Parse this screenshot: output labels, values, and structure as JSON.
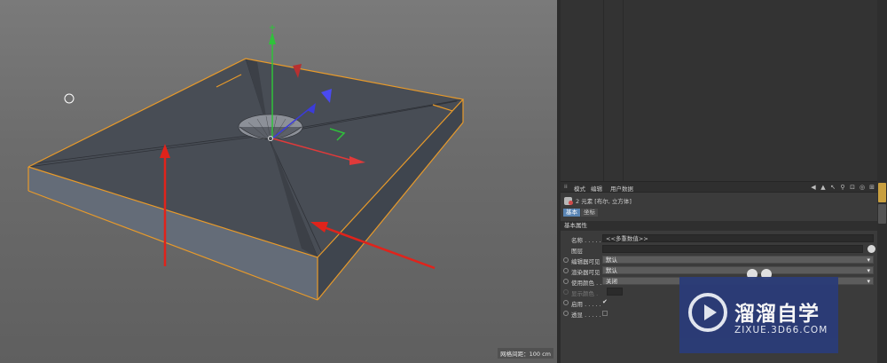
{
  "viewport": {
    "grid_label": "网格间距：100 cm"
  },
  "attributes": {
    "menu": [
      "模式",
      "编辑",
      "用户数据"
    ],
    "toolbar_icons": [
      "back-arrow-icon",
      "up-arrow-icon",
      "pointer-icon",
      "search-icon",
      "lock-icon",
      "target-icon",
      "new-window-icon"
    ],
    "object_info": "2 元素 [布尔, 立方体]",
    "tabs": [
      "基本",
      "坐标"
    ],
    "section_title": "基本属性",
    "rows": {
      "name_label": "名称 . . . . . .",
      "name_value": "<<多重数值>>",
      "layer_label": "图层",
      "editor_visible_label": "编辑器可见",
      "editor_visible_value": "默认",
      "render_visible_label": "渲染器可见",
      "render_visible_value": "默认",
      "use_color_label": "使用颜色 . .",
      "use_color_value": "关闭",
      "display_color_label": "显示颜色 .",
      "enable_label": "启用 . . . . .",
      "enable_value": "✔",
      "xray_label": "透显 . . . . ."
    }
  },
  "watermark": {
    "cn": "溜溜自学",
    "en": "ZIXUE.3D66.COM"
  },
  "colors": {
    "accent_tab": "#5b86b5",
    "selection_orange": "#e89a2a",
    "axis_x": "#e03a3a",
    "axis_y": "#2fc23a",
    "axis_z": "#3b3bd9",
    "annotation_red": "#e0231b",
    "watermark_bg": "#2b3c78"
  }
}
